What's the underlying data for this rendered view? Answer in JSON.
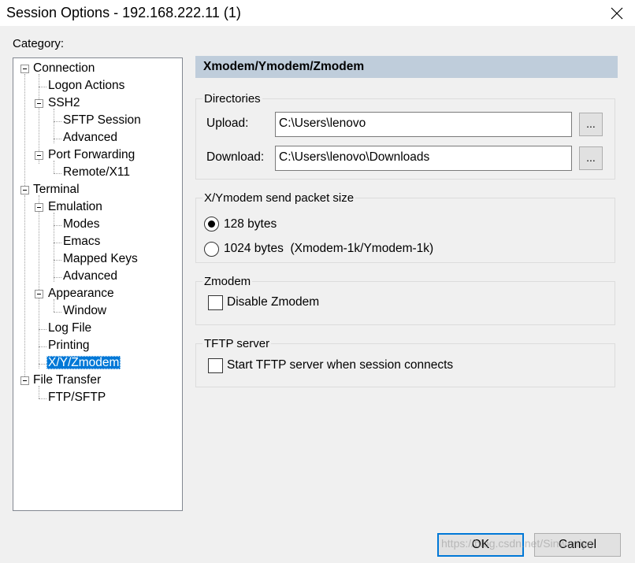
{
  "window": {
    "title": "Session Options - 192.168.222.11 (1)"
  },
  "category_label": "Category:",
  "tree": [
    {
      "label": "Connection"
    },
    {
      "label": "Logon Actions"
    },
    {
      "label": "SSH2"
    },
    {
      "label": "SFTP Session"
    },
    {
      "label": "Advanced"
    },
    {
      "label": "Port Forwarding"
    },
    {
      "label": "Remote/X11"
    },
    {
      "label": "Terminal"
    },
    {
      "label": "Emulation"
    },
    {
      "label": "Modes"
    },
    {
      "label": "Emacs"
    },
    {
      "label": "Mapped Keys"
    },
    {
      "label": "Advanced"
    },
    {
      "label": "Appearance"
    },
    {
      "label": "Window"
    },
    {
      "label": "Log File"
    },
    {
      "label": "Printing"
    },
    {
      "label": "X/Y/Zmodem"
    },
    {
      "label": "File Transfer"
    },
    {
      "label": "FTP/SFTP"
    }
  ],
  "selected_item": "X/Y/Zmodem",
  "panel": {
    "header": "Xmodem/Ymodem/Zmodem",
    "directories": {
      "title": "Directories",
      "upload_label": "Upload:",
      "upload_value": "C:\\Users\\lenovo",
      "download_label": "Download:",
      "download_value": "C:\\Users\\lenovo\\Downloads",
      "browse_label": "..."
    },
    "packet_size": {
      "title": "X/Ymodem send packet size",
      "option_128": "128 bytes",
      "option_1024": "1024 bytes  (Xmodem-1k/Ymodem-1k)",
      "selected": "128 bytes"
    },
    "zmodem": {
      "title": "Zmodem",
      "disable_label": "Disable Zmodem",
      "disable_checked": false
    },
    "tftp": {
      "title": "TFTP server",
      "start_label": "Start TFTP server when session connects",
      "start_checked": false
    }
  },
  "buttons": {
    "ok": "OK",
    "cancel": "Cancel"
  },
  "watermark": "https://blog.csdn.net/Sinwaniya",
  "colors": {
    "selection": "#0078d7",
    "header_bg": "#bfcddb",
    "default_button_border": "#0078d7"
  }
}
